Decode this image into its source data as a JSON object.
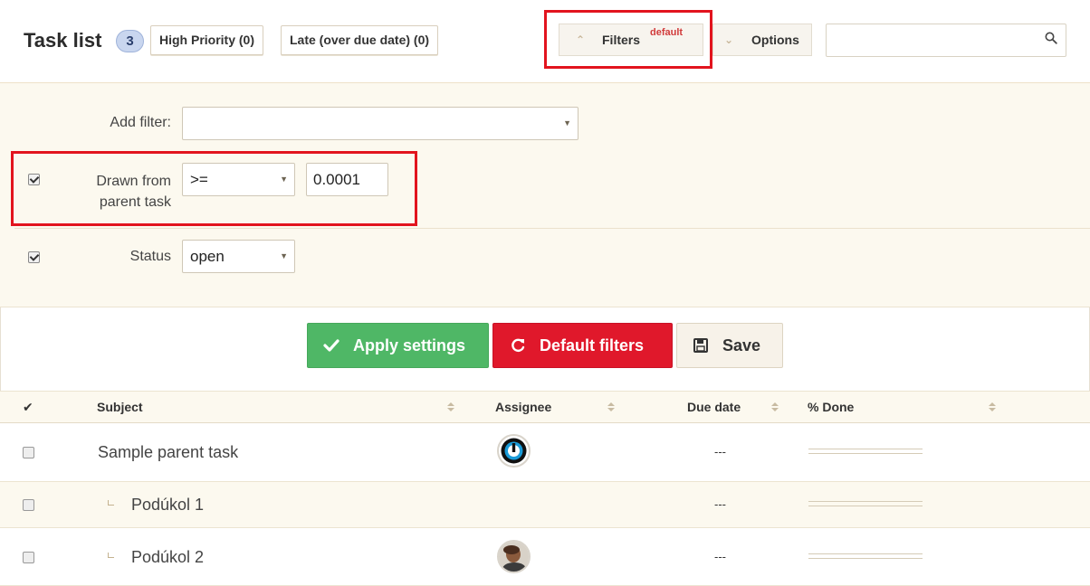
{
  "header": {
    "title": "Task list",
    "count": "3",
    "chips": {
      "high_priority": "High Priority (0)",
      "late": "Late (over due date) (0)"
    },
    "filters_button": {
      "label": "Filters",
      "tag": "default"
    },
    "options_button": {
      "label": "Options"
    },
    "search": {
      "value": "",
      "placeholder": ""
    }
  },
  "filters": {
    "add_filter_label": "Add filter:",
    "add_filter_value": "",
    "rows": [
      {
        "checked": true,
        "label": "Drawn from parent task",
        "operator": ">=",
        "value": "0.0001"
      },
      {
        "checked": true,
        "label": "Status",
        "operator": "open"
      }
    ]
  },
  "actions": {
    "apply": "Apply settings",
    "defaults": "Default filters",
    "save": "Save"
  },
  "table": {
    "columns": {
      "subject": "Subject",
      "assignee": "Assignee",
      "due": "Due date",
      "done": "% Done"
    },
    "rows": [
      {
        "subject": "Sample parent task",
        "assignee": "logo-avatar",
        "due": "---",
        "done": 0
      },
      {
        "subject": "Podúkol 1",
        "assignee": "",
        "due": "---",
        "done": 0
      },
      {
        "subject": "Podúkol 2",
        "assignee": "photo-avatar",
        "due": "---",
        "done": 0
      }
    ]
  },
  "colors": {
    "accent_green": "#4fb766",
    "accent_red": "#e0182b",
    "highlight": "#e2141e",
    "panel_bg": "#fcf9ef"
  },
  "icons": {
    "search": "search-icon",
    "filters": "chevron-up-icon",
    "options": "chevron-down-icon",
    "apply": "check-icon",
    "defaults": "refresh-icon",
    "save": "floppy-disk-icon"
  }
}
